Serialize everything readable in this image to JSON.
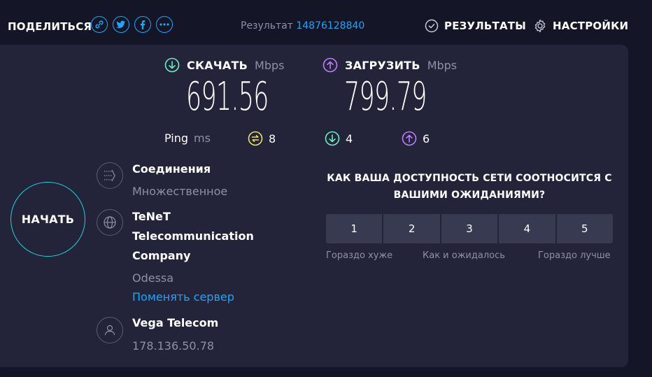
{
  "header": {
    "share_label": "ПОДЕЛИТЬСЯ",
    "share_icons": [
      "link-icon",
      "twitter-icon",
      "facebook-icon",
      "more-icon"
    ],
    "result_label": "Результат",
    "result_id": "14876128840",
    "results_link": "РЕЗУЛЬТАТЫ",
    "settings_link": "НАСТРОЙКИ"
  },
  "download": {
    "label": "СКАЧАТЬ",
    "unit": "Mbps",
    "value": "691.56",
    "color": "#6af0c4"
  },
  "upload": {
    "label": "ЗАГРУЗИТЬ",
    "unit": "Mbps",
    "value": "799.79",
    "color": "#c07cff"
  },
  "ping": {
    "label": "Ping",
    "unit": "ms",
    "idle": "8",
    "download": "4",
    "upload": "6",
    "idle_color": "#f0e06a"
  },
  "start_button": "НАЧАТЬ",
  "connections": {
    "title": "Соединения",
    "value": "Множественное"
  },
  "server": {
    "line1": "TeNeT",
    "line2": "Telecommunication",
    "line3": "Company",
    "city": "Odessa",
    "change_link": "Поменять сервер"
  },
  "provider": {
    "name": "Vega Telecom",
    "ip": "178.136.50.78"
  },
  "survey": {
    "question_line1": "КАК ВАША ДОСТУПНОСТЬ СЕТИ СООТНОСИТСЯ С",
    "question_line2": "ВАШИМИ ОЖИДАНИЯМИ?",
    "options": [
      "1",
      "2",
      "3",
      "4",
      "5"
    ],
    "label_low": "Гораздо хуже",
    "label_mid": "Как и ожидалось",
    "label_high": "Гораздо лучше"
  },
  "colors": {
    "accent": "#1fa5ff",
    "panel": "#232439",
    "background": "#141526",
    "start_ring": "#1dd2de"
  }
}
